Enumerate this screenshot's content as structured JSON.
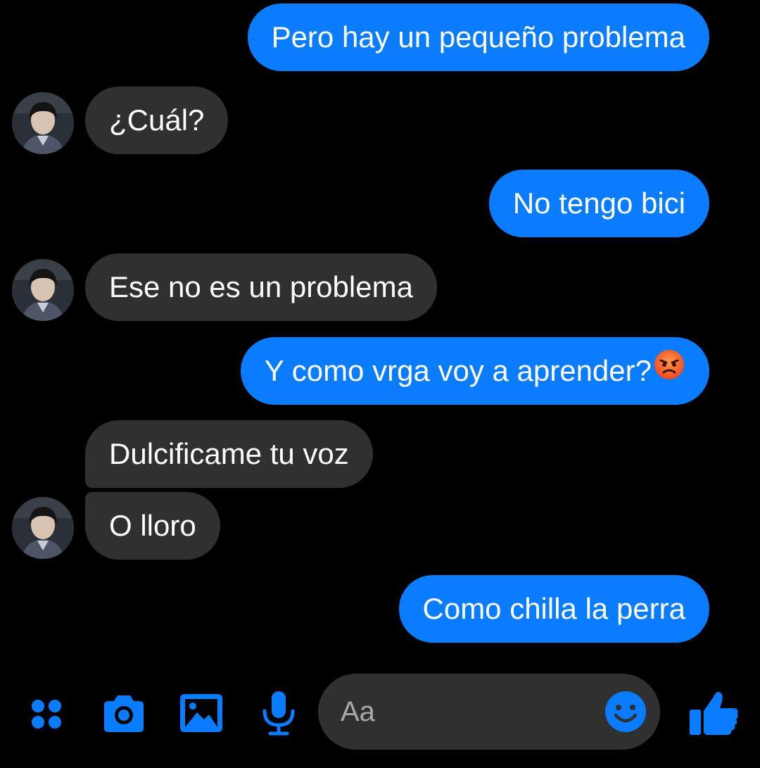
{
  "colors": {
    "background": "#000000",
    "outgoing_bubble": "#0a7cff",
    "incoming_bubble": "#303030",
    "icon_blue": "#0a7cff",
    "placeholder": "#a8a8a8"
  },
  "messages": [
    {
      "side": "outgoing",
      "text": "Pero hay un pequeño problema"
    },
    {
      "side": "incoming",
      "text": "¿Cuál?"
    },
    {
      "side": "outgoing",
      "text": "No tengo bici"
    },
    {
      "side": "incoming",
      "text": "Ese no es un problema"
    },
    {
      "side": "outgoing",
      "text": "Y como vrga voy a aprender?",
      "emoji": "angry-face-emoji"
    },
    {
      "side": "incoming",
      "text": "Dulcificame tu voz"
    },
    {
      "side": "incoming",
      "text": "O lloro"
    },
    {
      "side": "outgoing",
      "text": "Como chilla la perra"
    }
  ],
  "composer": {
    "placeholder": "Aa",
    "icons": [
      "menu-dots-icon",
      "camera-icon",
      "gallery-icon",
      "microphone-icon",
      "emoji-icon",
      "thumbs-up-icon"
    ]
  }
}
